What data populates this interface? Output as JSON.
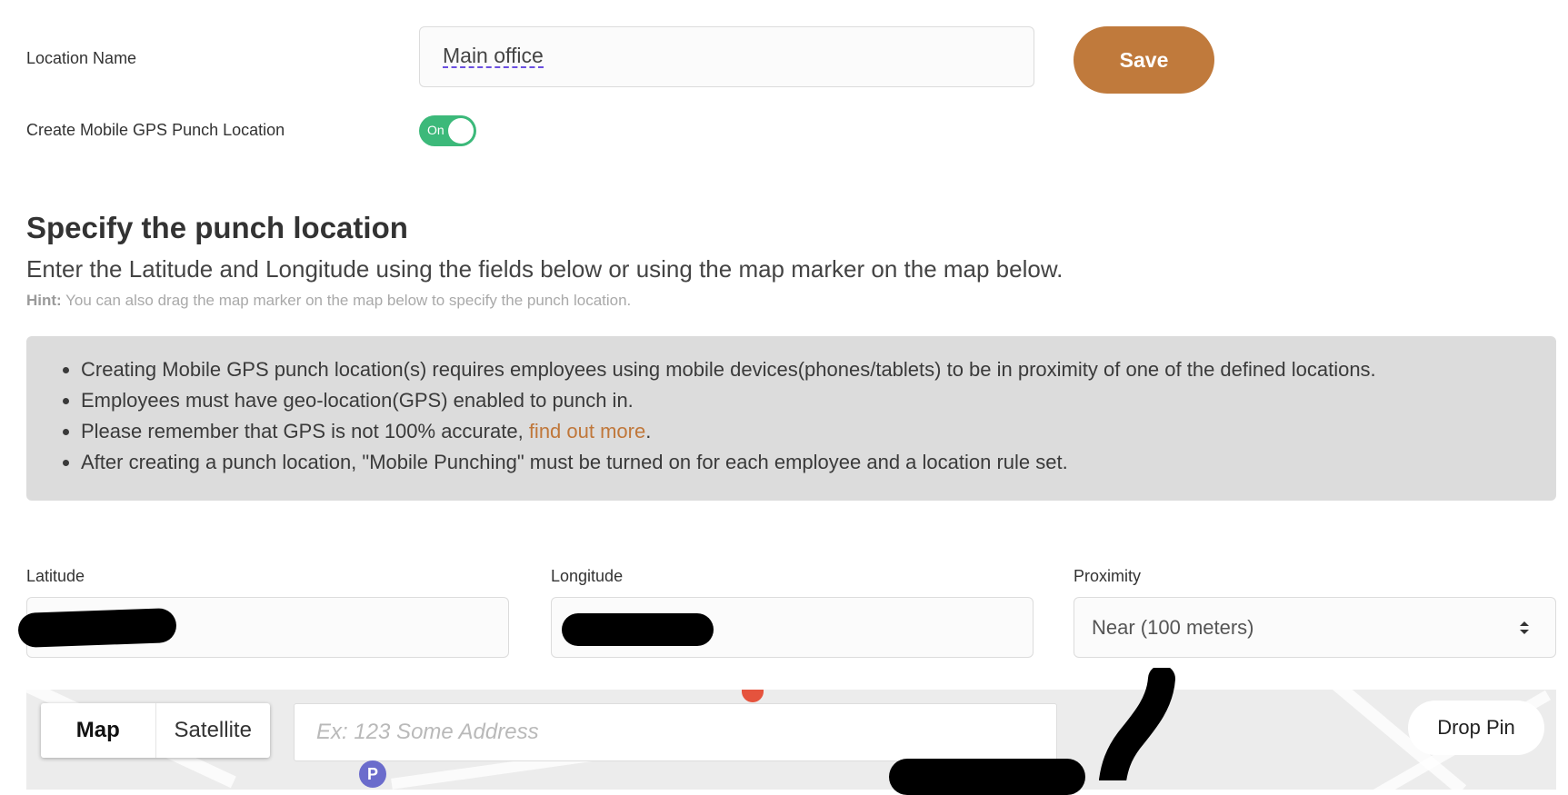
{
  "form": {
    "location_name_label": "Location Name",
    "location_name_value": "Main office",
    "save_label": "Save",
    "gps_label": "Create Mobile GPS Punch Location",
    "gps_toggle_text": "On"
  },
  "section": {
    "title": "Specify the punch location",
    "subtitle": "Enter the Latitude and Longitude using the fields below or using the map marker on the map below.",
    "hint_label": "Hint:",
    "hint_text": "You can also drag the map marker on the map below to specify the punch location."
  },
  "info": {
    "item1": "Creating Mobile GPS punch location(s) requires employees using mobile devices(phones/tablets) to be in proximity of one of the defined locations.",
    "item2": "Employees must have geo-location(GPS) enabled to punch in.",
    "item3_prefix": "Please remember that GPS is not 100% accurate, ",
    "item3_link": "find out more",
    "item3_suffix": ".",
    "item4": "After creating a punch location, \"Mobile Punching\" must be turned on for each employee and a location rule set."
  },
  "coords": {
    "latitude_label": "Latitude",
    "longitude_label": "Longitude",
    "proximity_label": "Proximity",
    "proximity_value": "Near (100 meters)"
  },
  "map": {
    "tab_map": "Map",
    "tab_satellite": "Satellite",
    "search_placeholder": "Ex: 123 Some Address",
    "drop_pin_label": "Drop Pin",
    "parking_marker": "P"
  },
  "colors": {
    "accent": "#c07a3c",
    "toggle_on": "#3cb97a",
    "link": "#c0773a"
  }
}
